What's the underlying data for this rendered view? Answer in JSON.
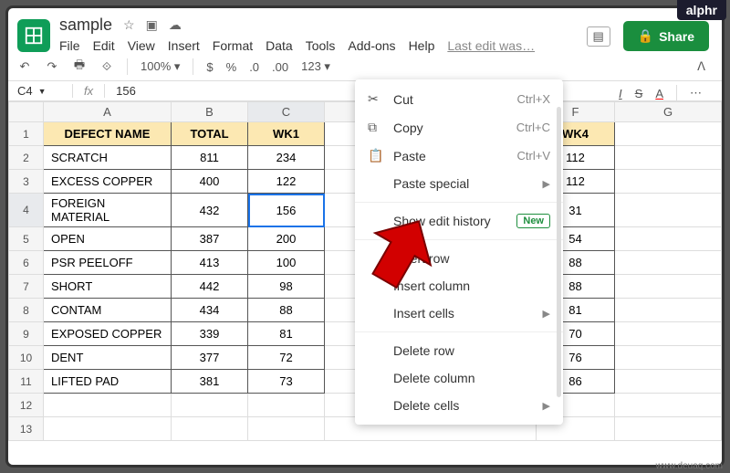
{
  "doc": {
    "title": "sample"
  },
  "menu": {
    "file": "File",
    "edit": "Edit",
    "view": "View",
    "insert": "Insert",
    "format": "Format",
    "data": "Data",
    "tools": "Tools",
    "addons": "Add-ons",
    "help": "Help",
    "last_edit": "Last edit was…"
  },
  "share": {
    "label": "Share"
  },
  "toolbar": {
    "zoom": "100%",
    "currency": "$",
    "percent": "%",
    "dec0": ".0",
    "dec00": ".00",
    "num123": "123"
  },
  "fx": {
    "cell": "C4",
    "value": "156"
  },
  "cols": {
    "A": "A",
    "B": "B",
    "C": "C",
    "F": "F",
    "G": "G"
  },
  "headers": {
    "defect": "DEFECT NAME",
    "total": "TOTAL",
    "wk1": "WK1",
    "wk4": "WK4"
  },
  "rows": [
    {
      "name": "SCRATCH",
      "total": 811,
      "wk1": 234,
      "wk4": 112
    },
    {
      "name": "EXCESS COPPER",
      "total": 400,
      "wk1": 122,
      "wk4": 112
    },
    {
      "name": "FOREIGN MATERIAL",
      "total": 432,
      "wk1": 156,
      "wk4": 31
    },
    {
      "name": "OPEN",
      "total": 387,
      "wk1": 200,
      "wk4": 54
    },
    {
      "name": "PSR PEELOFF",
      "total": 413,
      "wk1": 100,
      "wk4": 88
    },
    {
      "name": "SHORT",
      "total": 442,
      "wk1": 98,
      "wk4": 88
    },
    {
      "name": "CONTAM",
      "total": 434,
      "wk1": 88,
      "wk4": 81
    },
    {
      "name": "EXPOSED COPPER",
      "total": 339,
      "wk1": 81,
      "wk4": 70
    },
    {
      "name": "DENT",
      "total": 377,
      "wk1": 72,
      "wk4": 76
    },
    {
      "name": "LIFTED PAD",
      "total": 381,
      "wk1": 73,
      "wk4": 86
    }
  ],
  "ctx": {
    "cut": "Cut",
    "cut_k": "Ctrl+X",
    "copy": "Copy",
    "copy_k": "Ctrl+C",
    "paste": "Paste",
    "paste_k": "Ctrl+V",
    "paste_special": "Paste special",
    "show_history": "Show edit history",
    "new_badge": "New",
    "insert_row": "Insert row",
    "insert_col": "Insert column",
    "insert_cells": "Insert cells",
    "delete_row": "Delete row",
    "delete_col": "Delete column",
    "delete_cells": "Delete cells"
  },
  "brand": "alphr",
  "watermark": "www.deuaq.com"
}
